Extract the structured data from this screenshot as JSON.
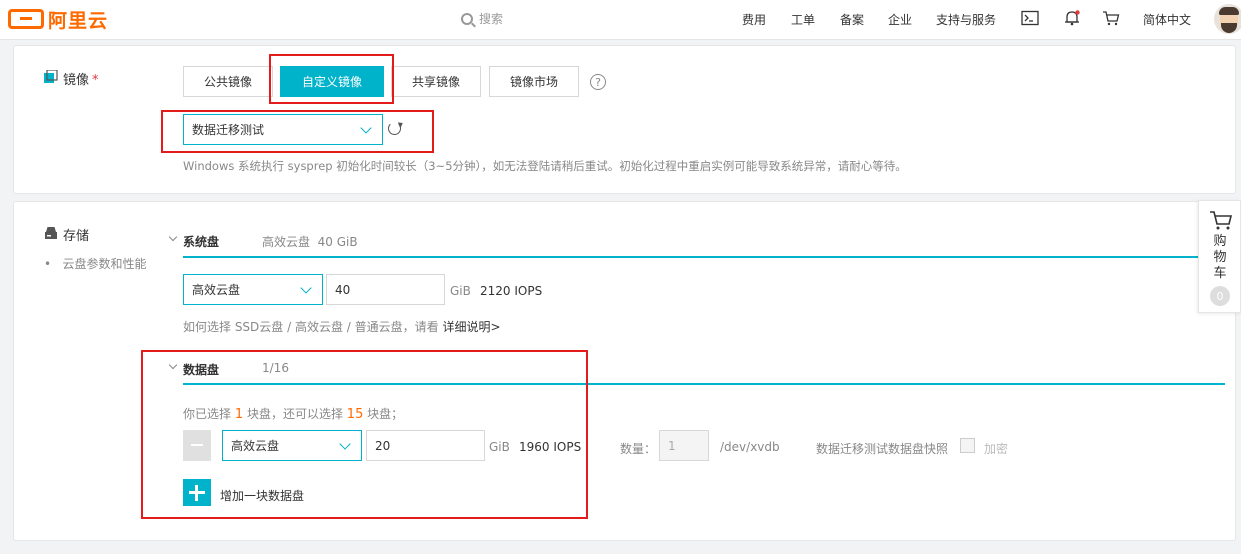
{
  "brand": {
    "logo_text": "阿里云"
  },
  "search": {
    "placeholder": "搜索"
  },
  "nav": {
    "links": [
      "费用",
      "工单",
      "备案",
      "企业",
      "支持与服务"
    ],
    "language": "简体中文"
  },
  "image_section": {
    "title": "镜像",
    "required_mark": "*",
    "tabs": [
      "公共镜像",
      "自定义镜像",
      "共享镜像",
      "镜像市场"
    ],
    "active_tab": "自定义镜像",
    "help_glyph": "?",
    "selected_image": "数据迁移测试",
    "note": "Windows 系统执行 sysprep 初始化时间较长（3~5分钟），如无法登陆请稍后重试。初始化过程中重启实例可能导致系统异常，请耐心等待。"
  },
  "storage_section": {
    "title": "存储",
    "sub_link": "云盘参数和性能",
    "system_disk": {
      "label": "系统盘",
      "summary": "高效云盘  40 GiB",
      "type": "高效云盘",
      "size": "40",
      "unit": "GiB",
      "iops": "2120 IOPS",
      "help_text": "如何选择 SSD云盘 / 高效云盘 / 普通云盘，请看",
      "help_link": "详细说明>"
    },
    "data_disk": {
      "label": "数据盘",
      "count": "1/16",
      "selected_prefix": "你已选择",
      "selected_num": "1",
      "selected_mid": "块盘，还可以选择",
      "remaining_num": "15",
      "selected_suffix": "块盘；",
      "type": "高效云盘",
      "size": "20",
      "unit": "GiB",
      "iops": "1960 IOPS",
      "qty_label": "数量：",
      "qty_value": "1",
      "device": "/dev/xvdb",
      "snapshot_label": "数据迁移测试数据盘快照",
      "encrypt_label": "加密",
      "add_label": "增加一块数据盘"
    }
  },
  "cart": {
    "label": "购物车",
    "count": "0"
  },
  "colors": {
    "accent": "#00b2ca",
    "brand": "#ff6a00",
    "highlight": "#e31b1b"
  }
}
